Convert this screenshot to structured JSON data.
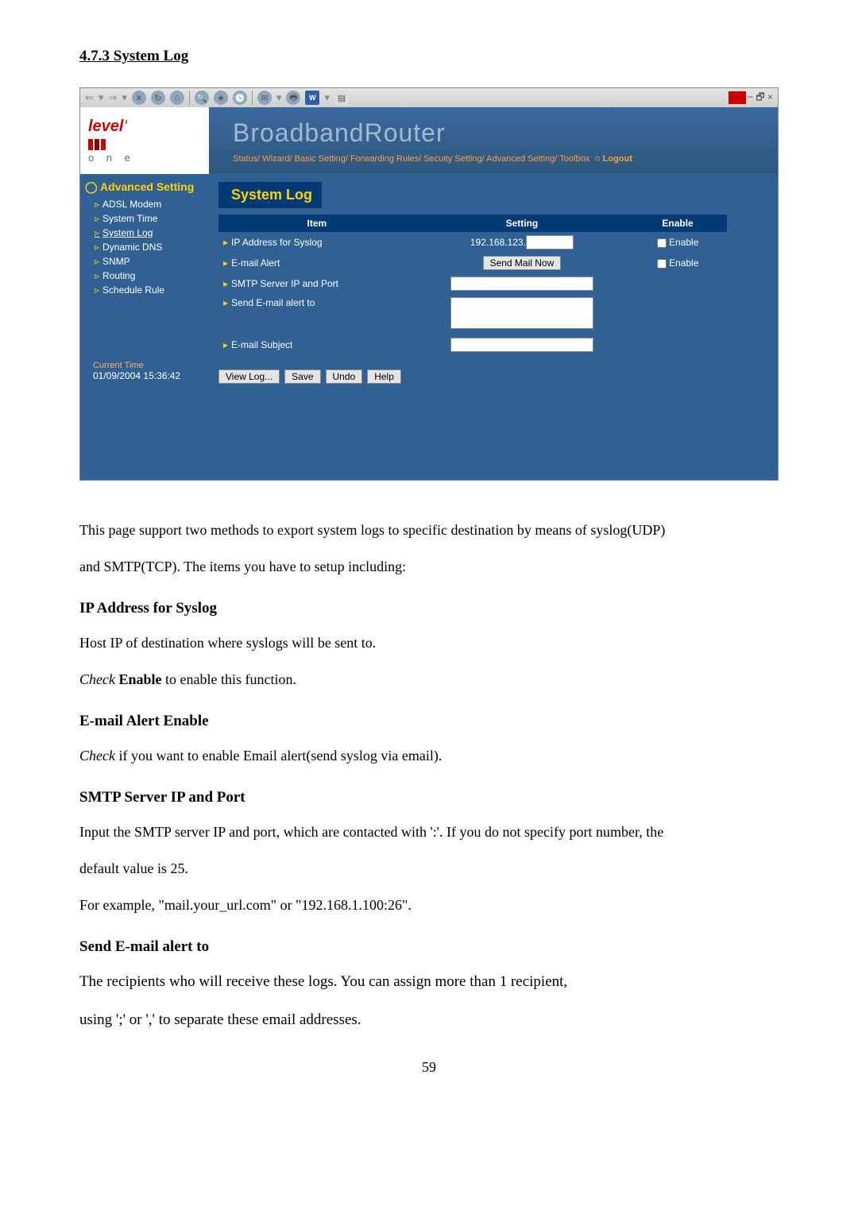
{
  "heading_section": "4.7.3 System Log",
  "toolbar": {
    "maximize": "−  🗗  ×"
  },
  "banner": {
    "logo": "level",
    "logo_sub": "o n e",
    "title": "BroadbandRouter",
    "crumbs": "Status/ Wizard/ Basic Setting/ Forwarding Rules/ Secuity Setting/ Advanced Setting/ Toolbox",
    "logout": "Logout"
  },
  "sidebar": {
    "head": "Advanced Setting",
    "items": [
      "ADSL Modem",
      "System Time",
      "System Log",
      "Dynamic DNS",
      "SNMP",
      "Routing",
      "Schedule Rule"
    ],
    "current_label": "Current Time",
    "current_time": "01/09/2004 15:36:42"
  },
  "panel": {
    "title": "System Log",
    "headers": {
      "item": "Item",
      "setting": "Setting",
      "enable": "Enable"
    },
    "rows": {
      "ip": {
        "label": "IP Address for Syslog",
        "value": "192.168.123.",
        "enable_label": "Enable"
      },
      "email": {
        "label": "E-mail Alert",
        "btn": "Send Mail Now",
        "enable_label": "Enable"
      },
      "smtp": {
        "label": "SMTP Server IP and Port"
      },
      "sendto": {
        "label": "Send E-mail alert to"
      },
      "subject": {
        "label": "E-mail Subject"
      }
    },
    "buttons": {
      "view": "View Log...",
      "save": "Save",
      "undo": "Undo",
      "help": "Help"
    }
  },
  "desc": {
    "intro1": "This page support two methods to export system logs to specific destination by means of syslog(UDP)",
    "intro2": "and SMTP(TCP). The items you have to setup including:",
    "ip_h": "IP Address for Syslog",
    "ip_p1": "Host IP of destination where syslogs will be sent to.",
    "ip_p2a": "Check ",
    "ip_p2b": "Enable",
    "ip_p2c": " to enable this function.",
    "em_h": "E-mail Alert Enable",
    "em_p1a": "Check",
    "em_p1b": " if you want to enable Email alert(send syslog via email).",
    "smtp_h": "SMTP Server IP and Port",
    "smtp_p1": "Input the SMTP server IP and port, which are contacted with ':'. If you do not specify port number, the",
    "smtp_p2": "default value is 25.",
    "smtp_p3": "For example, \"mail.your_url.com\" or \"192.168.1.100:26\".",
    "send_h": "Send E-mail alert to",
    "send_p1": "The recipients who will receive these logs. You can assign more than 1 recipient,",
    "send_p2": "using ';' or ',' to separate these email addresses."
  },
  "page_number": "59"
}
